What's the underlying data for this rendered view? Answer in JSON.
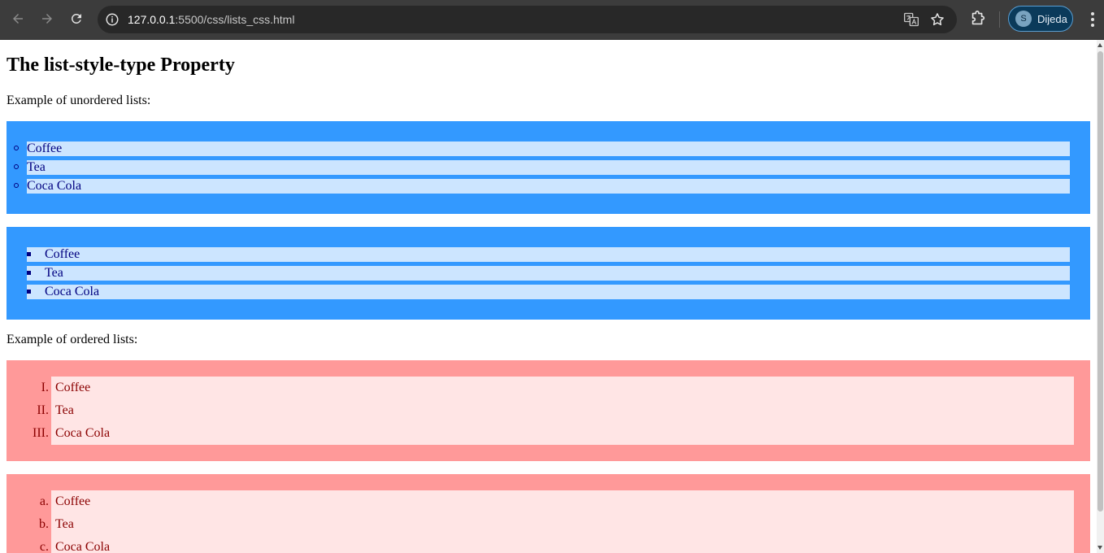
{
  "browser": {
    "url_host": "127.0.0.1",
    "url_rest": ":5500/css/lists_css.html",
    "profile_initial": "S",
    "profile_name": "Dijeda"
  },
  "page": {
    "title": "The list-style-type Property",
    "unordered_intro": "Example of unordered lists:",
    "ordered_intro": "Example of ordered lists:",
    "ul_circle": [
      "Coffee",
      "Tea",
      "Coca Cola"
    ],
    "ul_square": [
      "Coffee",
      "Tea",
      "Coca Cola"
    ],
    "ol_roman": {
      "markers": [
        "I.",
        "II.",
        "III."
      ],
      "items": [
        "Coffee",
        "Tea",
        "Coca Cola"
      ]
    },
    "ol_alpha": {
      "markers": [
        "a.",
        "b.",
        "c."
      ],
      "items": [
        "Coffee",
        "Tea",
        "Coca Cola"
      ]
    }
  },
  "colors": {
    "ul_background": "#3399ff",
    "ul_item_background": "#cce5ff",
    "ol_background": "#ff9999",
    "ol_item_background": "#ffe5e5"
  }
}
